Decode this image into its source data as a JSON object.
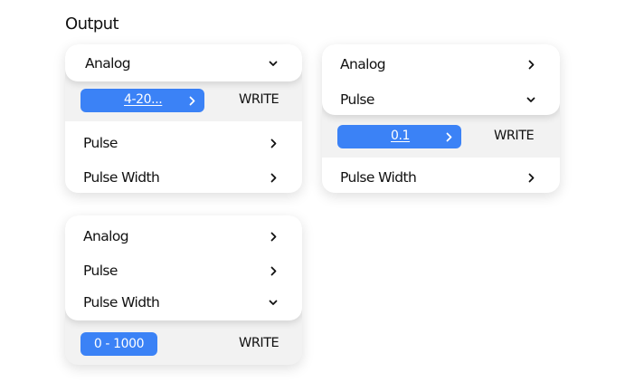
{
  "page": {
    "title": "Output"
  },
  "colors": {
    "accent": "#3b82f6",
    "panel_bg": "#f2f2f2",
    "card_bg": "#ffffff"
  },
  "cards": [
    {
      "analog_label": "Analog",
      "value": "4-20...",
      "write_label": "WRITE",
      "pulse_label": "Pulse",
      "pulse_width_label": "Pulse Width"
    },
    {
      "analog_label": "Analog",
      "pulse_label": "Pulse",
      "value": "0.1",
      "write_label": "WRITE",
      "pulse_width_label": "Pulse Width"
    },
    {
      "analog_label": "Analog",
      "pulse_label": "Pulse",
      "pulse_width_label": "Pulse Width",
      "value": "0 - 1000",
      "write_label": "WRITE"
    }
  ]
}
